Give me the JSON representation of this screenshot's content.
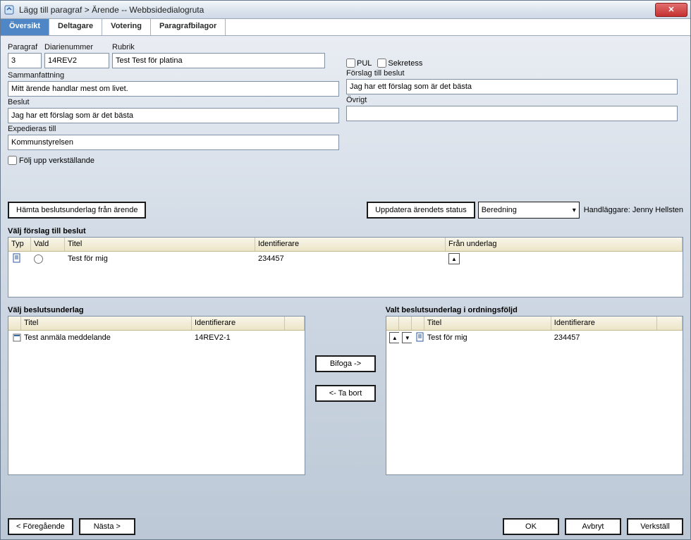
{
  "window": {
    "title": "Lägg till paragraf > Ärende -- Webbsidedialogruta"
  },
  "tabs": {
    "items": [
      {
        "label": "Översikt",
        "active": true
      },
      {
        "label": "Deltagare",
        "active": false
      },
      {
        "label": "Votering",
        "active": false
      },
      {
        "label": "Paragrafbilagor",
        "active": false
      }
    ]
  },
  "form": {
    "paragraf_label": "Paragraf",
    "paragraf_value": "3",
    "diarienummer_label": "Diarienummer",
    "diarienummer_value": "14REV2",
    "rubrik_label": "Rubrik",
    "rubrik_value": "Test Test för platina",
    "pul_label": "PUL",
    "sekretess_label": "Sekretess",
    "sammanfattning_label": "Sammanfattning",
    "sammanfattning_value": "Mitt ärende handlar mest om livet.",
    "forslag_label": "Förslag till beslut",
    "forslag_value": "Jag har ett förslag som är det bästa",
    "beslut_label": "Beslut",
    "beslut_value": "Jag har ett förslag som är det bästa",
    "ovrigt_label": "Övrigt",
    "ovrigt_value": "",
    "expediering_label": "Expedieras till",
    "expediering_value": "Kommunstyrelsen",
    "folj_upp_label": "Följ upp verkställande"
  },
  "actions": {
    "hemta_label": "Hämta beslutsunderlag från ärende",
    "uppdatera_label": "Uppdatera ärendets status",
    "status_value": "Beredning",
    "handlaggare_label": "Handläggare:",
    "handlaggare_value": "Jenny Hellsten"
  },
  "proposal": {
    "title": "Välj förslag till beslut",
    "cols": {
      "typ": "Typ",
      "vald": "Vald",
      "titel": "Titel",
      "identifierare": "Identifierare",
      "fran": "Från underlag"
    },
    "rows": [
      {
        "titel": "Test för mig",
        "identifierare": "234457"
      }
    ]
  },
  "underlag_left": {
    "title": "Välj beslutsunderlag",
    "cols": {
      "titel": "Titel",
      "identifierare": "Identifierare"
    },
    "rows": [
      {
        "titel": "Test anmäla meddelande",
        "identifierare": "14REV2-1"
      }
    ]
  },
  "underlag_right": {
    "title": "Valt beslutsunderlag i ordningsföljd",
    "cols": {
      "titel": "Titel",
      "identifierare": "Identifierare"
    },
    "rows": [
      {
        "titel": "Test för mig",
        "identifierare": "234457"
      }
    ]
  },
  "mid_buttons": {
    "bifoga": "Bifoga ->",
    "tabort": "<- Ta bort"
  },
  "footer": {
    "prev": "< Föregående",
    "next": "Nästa >",
    "ok": "OK",
    "cancel": "Avbryt",
    "apply": "Verkställ"
  }
}
